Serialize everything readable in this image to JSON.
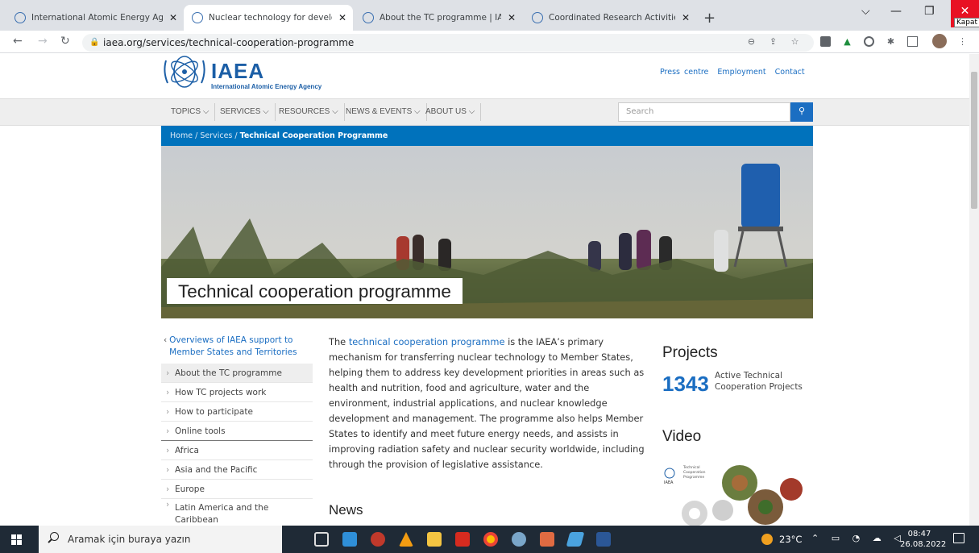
{
  "browser": {
    "tabs": [
      {
        "title": "International Atomic Energy Age",
        "active": false
      },
      {
        "title": "Nuclear technology for developn",
        "active": true
      },
      {
        "title": "About the TC programme | IAEA",
        "active": false
      },
      {
        "title": "Coordinated Research Activities |",
        "active": false
      }
    ],
    "new_tab": "+",
    "close_tooltip": "Kapat",
    "url": "iaea.org/services/technical-cooperation-programme"
  },
  "site": {
    "logo_text": "IAEA",
    "logo_subtitle": "International Atomic Energy Agency",
    "util_links": [
      "Press centre",
      "Employment",
      "Contact"
    ],
    "nav": [
      "TOPICS",
      "SERVICES",
      "RESOURCES",
      "NEWS & EVENTS",
      "ABOUT US"
    ],
    "search_placeholder": "Search",
    "breadcrumb": {
      "home": "Home",
      "services": "Services",
      "current": "Technical Cooperation Programme"
    },
    "hero_title": "Technical cooperation programme",
    "sidenav": {
      "heading": "Overviews of IAEA support to Member States and Territories",
      "items": [
        "About the TC programme",
        "How TC projects work",
        "How to participate",
        "Online tools"
      ],
      "regions": [
        "Africa",
        "Asia and the Pacific",
        "Europe",
        "Latin America and the Caribbean"
      ]
    },
    "intro_prefix": "The ",
    "intro_link": "technical cooperation programme",
    "intro_text": " is the IAEA’s primary mechanism for transferring nuclear technology to Member States, helping them to address key development priorities in areas such as health and nutrition, food and agriculture, water and the environment, industrial applications, and nuclear knowledge development and management. The programme also helps Member States to identify and meet future energy needs, and assists in improving radiation safety and nuclear security worldwide, including through the provision of legislative assistance.",
    "news_heading": "News",
    "projects_heading": "Projects",
    "projects_count": "1343",
    "projects_label": "Active Technical Cooperation Projects",
    "video_heading": "Video",
    "video_thumb_lines": [
      "Technical",
      "Cooperation",
      "Programme"
    ],
    "video_thumb_logo": "IAEA"
  },
  "taskbar": {
    "search_placeholder": "Aramak için buraya yazın",
    "temperature": "23°C",
    "time": "08:47",
    "date": "26.08.2022"
  }
}
